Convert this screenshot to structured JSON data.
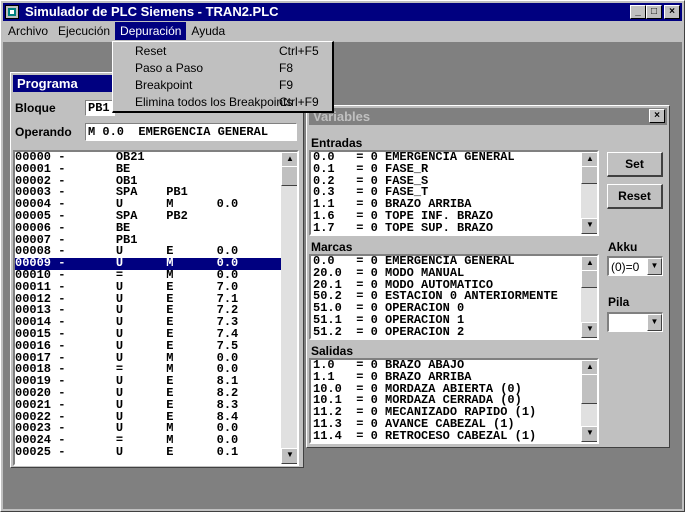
{
  "window": {
    "title": "Simulador de PLC Siemens - TRAN2.PLC",
    "minimize": "_",
    "maximize": "□",
    "close": "×"
  },
  "menu": {
    "items": [
      "Archivo",
      "Ejecución",
      "Depuración",
      "Ayuda"
    ]
  },
  "dropdown": {
    "items": [
      {
        "label": "Reset",
        "shortcut": "Ctrl+F5"
      },
      {
        "label": "Paso a Paso",
        "shortcut": "F8"
      },
      {
        "label": "Breakpoint",
        "shortcut": "F9"
      },
      {
        "label": "Elimina todos los Breakpoints",
        "shortcut": "Ctrl+F9"
      }
    ]
  },
  "programa": {
    "title": "Programa",
    "bloque_label": "Bloque",
    "bloque_value": "PB1",
    "operando_label": "Operando",
    "operando_value": "M 0.0  EMERGENCIA GENERAL",
    "lines": [
      "00000 -       OB21",
      "00001 -       BE",
      "00002 -       OB1",
      "00003 -       SPA    PB1",
      "00004 -       U      M      0.0",
      "00005 -       SPA    PB2",
      "00006 -       BE",
      "00007 -       PB1",
      "00008 -       U      E      0.0",
      "00009 -       U      M      0.0",
      "00010 -       =      M      0.0",
      "00011 -       U      E      7.0",
      "00012 -       U      E      7.1",
      "00013 -       U      E      7.2",
      "00014 -       U      E      7.3",
      "00015 -       U      E      7.4",
      "00016 -       U      E      7.5",
      "00017 -       U      M      0.0",
      "00018 -       =      M      0.0",
      "00019 -       U      E      8.1",
      "00020 -       U      E      8.2",
      "00021 -       U      E      8.3",
      "00022 -       U      E      8.4",
      "00023 -       U      M      0.0",
      "00024 -       =      M      0.0",
      "00025 -       U      E      0.1"
    ],
    "selected_index": 9
  },
  "variables": {
    "title": "Variables",
    "close": "×",
    "entradas_label": "Entradas",
    "entradas": [
      "0.0   = 0 EMERGENCIA GENERAL",
      "0.1   = 0 FASE_R",
      "0.2   = 0 FASE_S",
      "0.3   = 0 FASE_T",
      "1.1   = 0 BRAZO ARRIBA",
      "1.6   = 0 TOPE INF. BRAZO",
      "1.7   = 0 TOPE SUP. BRAZO"
    ],
    "marcas_label": "Marcas",
    "marcas": [
      "0.0   = 0 EMERGENCIA GENERAL",
      "20.0  = 0 MODO MANUAL",
      "20.1  = 0 MODO AUTOMATICO",
      "50.2  = 0 ESTACION 0 ANTERIORMENTE",
      "51.0  = 0 OPERACION 0",
      "51.1  = 0 OPERACION 1",
      "51.2  = 0 OPERACION 2"
    ],
    "salidas_label": "Salidas",
    "salidas": [
      "1.0   = 0 BRAZO ABAJO",
      "1.1   = 0 BRAZO ARRIBA",
      "10.0  = 0 MORDAZA ABIERTA (0)",
      "10.1  = 0 MORDAZA CERRADA (0)",
      "11.2  = 0 MECANIZADO RAPIDO (1)",
      "11.3  = 0 AVANCE CABEZAL (1)",
      "11.4  = 0 RETROCESO CABEZAL (1)"
    ],
    "set_label": "Set",
    "reset_label": "Reset",
    "akku_label": "Akku",
    "akku_value": "(0)=0",
    "pila_label": "Pila",
    "pila_value": ""
  }
}
